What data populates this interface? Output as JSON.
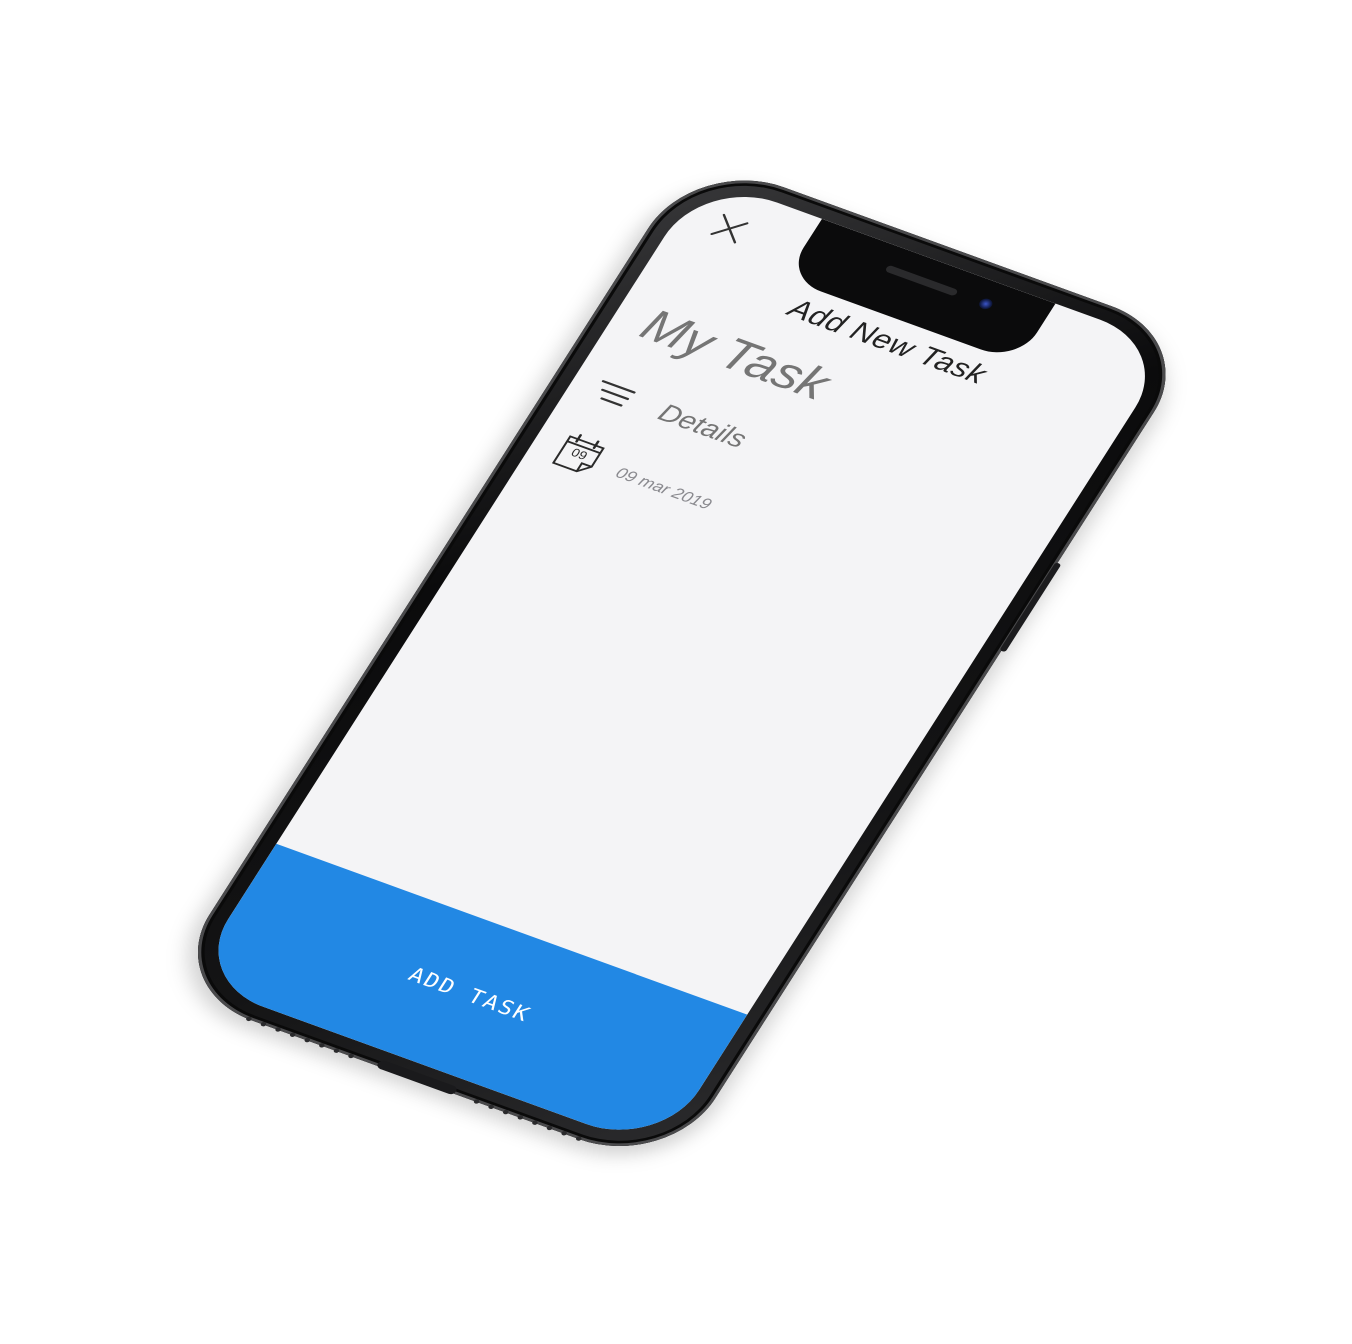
{
  "header": {
    "title": "Add New Task"
  },
  "form": {
    "task_name_placeholder": "My Task",
    "details_placeholder": "Details",
    "calendar_day": "09",
    "date": "09 mar 2019"
  },
  "footer": {
    "add_button_label": "ADD TASK"
  },
  "icons": {
    "close": "close-icon",
    "details": "menu-lines-icon",
    "date": "calendar-icon"
  },
  "colors": {
    "accent": "#2288e4",
    "screen_background": "#f4f4f6",
    "phone_frame": "#0b0b0c"
  }
}
